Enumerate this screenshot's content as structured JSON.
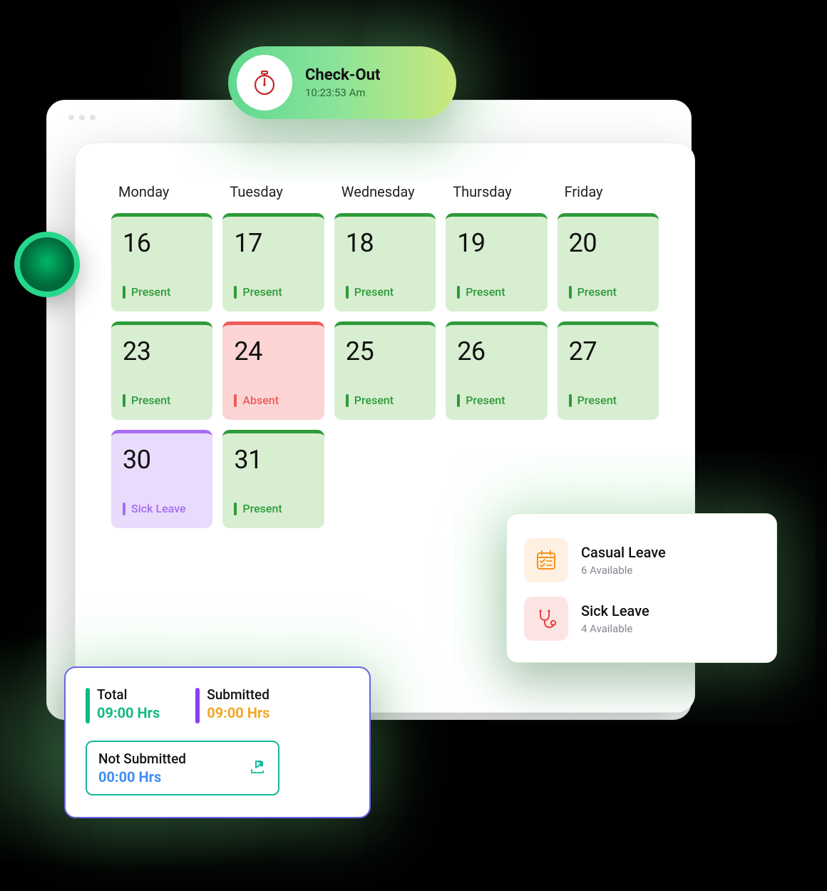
{
  "checkout": {
    "title": "Check-Out",
    "time": "10:23:53 Am"
  },
  "weekdays": [
    "Monday",
    "Tuesday",
    "Wednesday",
    "Thursday",
    "Friday"
  ],
  "days": [
    {
      "num": "16",
      "status": "Present",
      "type": "present"
    },
    {
      "num": "17",
      "status": "Present",
      "type": "present"
    },
    {
      "num": "18",
      "status": "Present",
      "type": "present"
    },
    {
      "num": "19",
      "status": "Present",
      "type": "present"
    },
    {
      "num": "20",
      "status": "Present",
      "type": "present"
    },
    {
      "num": "23",
      "status": "Present",
      "type": "present"
    },
    {
      "num": "24",
      "status": "Absent",
      "type": "absent"
    },
    {
      "num": "25",
      "status": "Present",
      "type": "present"
    },
    {
      "num": "26",
      "status": "Present",
      "type": "present"
    },
    {
      "num": "27",
      "status": "Present",
      "type": "present"
    },
    {
      "num": "30",
      "status": "Sick Leave",
      "type": "sick"
    },
    {
      "num": "31",
      "status": "Present",
      "type": "present"
    }
  ],
  "leaves": {
    "casual": {
      "title": "Casual Leave",
      "sub": "6 Available"
    },
    "sick": {
      "title": "Sick Leave",
      "sub": "4 Available"
    }
  },
  "hours": {
    "total": {
      "label": "Total",
      "value": "09:00 Hrs"
    },
    "submitted": {
      "label": "Submitted",
      "value": "09:00 Hrs"
    },
    "not_submitted": {
      "label": "Not Submitted",
      "value": "00:00 Hrs"
    }
  }
}
